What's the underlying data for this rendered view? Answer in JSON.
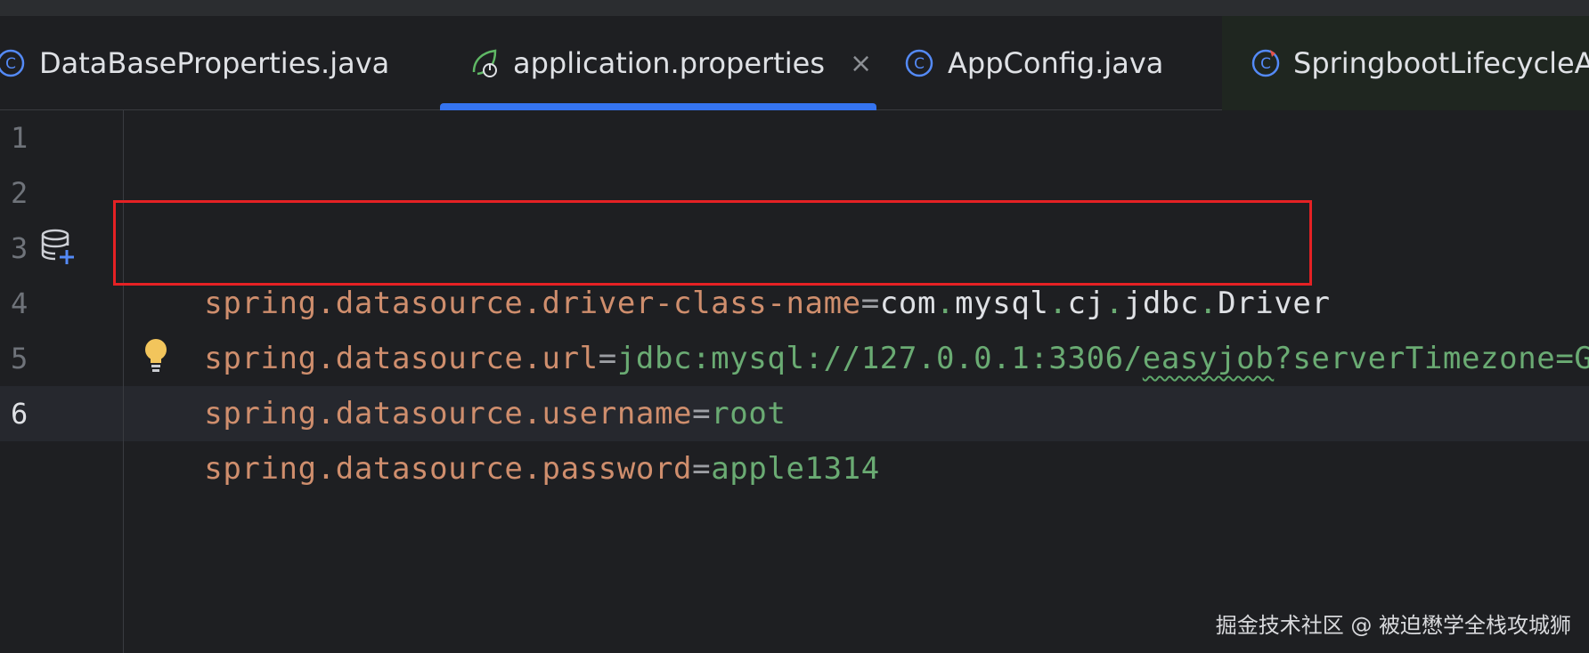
{
  "tabs": [
    {
      "label": "DataBaseProperties.java",
      "icon": "java-class-icon"
    },
    {
      "label": "application.properties",
      "icon": "spring-properties-icon",
      "active": true,
      "close": "×"
    },
    {
      "label": "AppConfig.java",
      "icon": "java-class-icon"
    },
    {
      "label": "SpringbootLifecycleAp",
      "icon": "spring-boot-class-icon"
    }
  ],
  "editor": {
    "line_numbers": [
      "1",
      "2",
      "3",
      "4",
      "5",
      "6"
    ],
    "lines": {
      "l3": {
        "key": "spring.datasource.driver-class-name",
        "eq": "=",
        "v1": "com",
        "d1": ".",
        "v2": "mysql",
        "d2": ".",
        "v3": "cj",
        "d3": ".",
        "v4": "jdbc",
        "d4": ".",
        "v5": "Driver"
      },
      "l4": {
        "key": "spring.datasource.url",
        "eq": "=",
        "v1": "jdbc:mysql://127.0.0.1:3306/",
        "v2": "easyjob",
        "v3": "?serverTimezone=GMT"
      },
      "l5": {
        "key": "spring.datasource.username",
        "eq": "=",
        "v1": "root"
      },
      "l6": {
        "key": "spring.datasource.password",
        "eq": "=",
        "v1": "apple1314"
      }
    },
    "current_line": "6"
  },
  "colors": {
    "accent": "#3574f0",
    "highlight_box": "#e52124",
    "key": "#cf8e6d",
    "value": "#6aab73"
  },
  "watermark": "掘金技术社区 @ 被迫懋学全栈攻城狮"
}
